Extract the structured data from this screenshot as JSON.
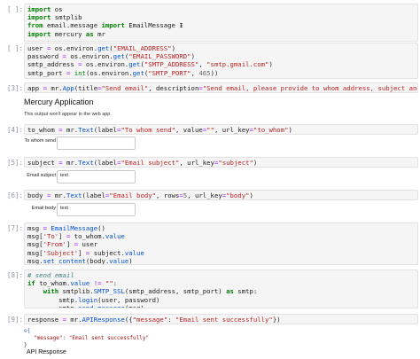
{
  "cells": {
    "c0": {
      "prompt": "[ ]:"
    },
    "c1": {
      "prompt": "[ ]:"
    },
    "c2": {
      "prompt": "[3]:"
    },
    "c3": {
      "prompt": "[4]:"
    },
    "c4": {
      "prompt": "[5]:"
    },
    "c5": {
      "prompt": "[6]:"
    },
    "c6": {
      "prompt": "[7]:"
    },
    "c7": {
      "prompt": "[8]:"
    },
    "c8": {
      "prompt": "[9]:"
    }
  },
  "app": {
    "heading": "Mercury Application",
    "note": "This output won't appear in the web app."
  },
  "widgets": {
    "to_whom": {
      "label": "To whom send",
      "value": ""
    },
    "subject": {
      "label": "Email subject",
      "value": "text"
    },
    "body": {
      "label": "Email body",
      "value": "text"
    }
  },
  "output": {
    "collapse_label": "⊖{",
    "json_key": "\"message\"",
    "json_value": "\"Email sent successfully\"",
    "close_brace": "}",
    "api_response": "API Response"
  }
}
